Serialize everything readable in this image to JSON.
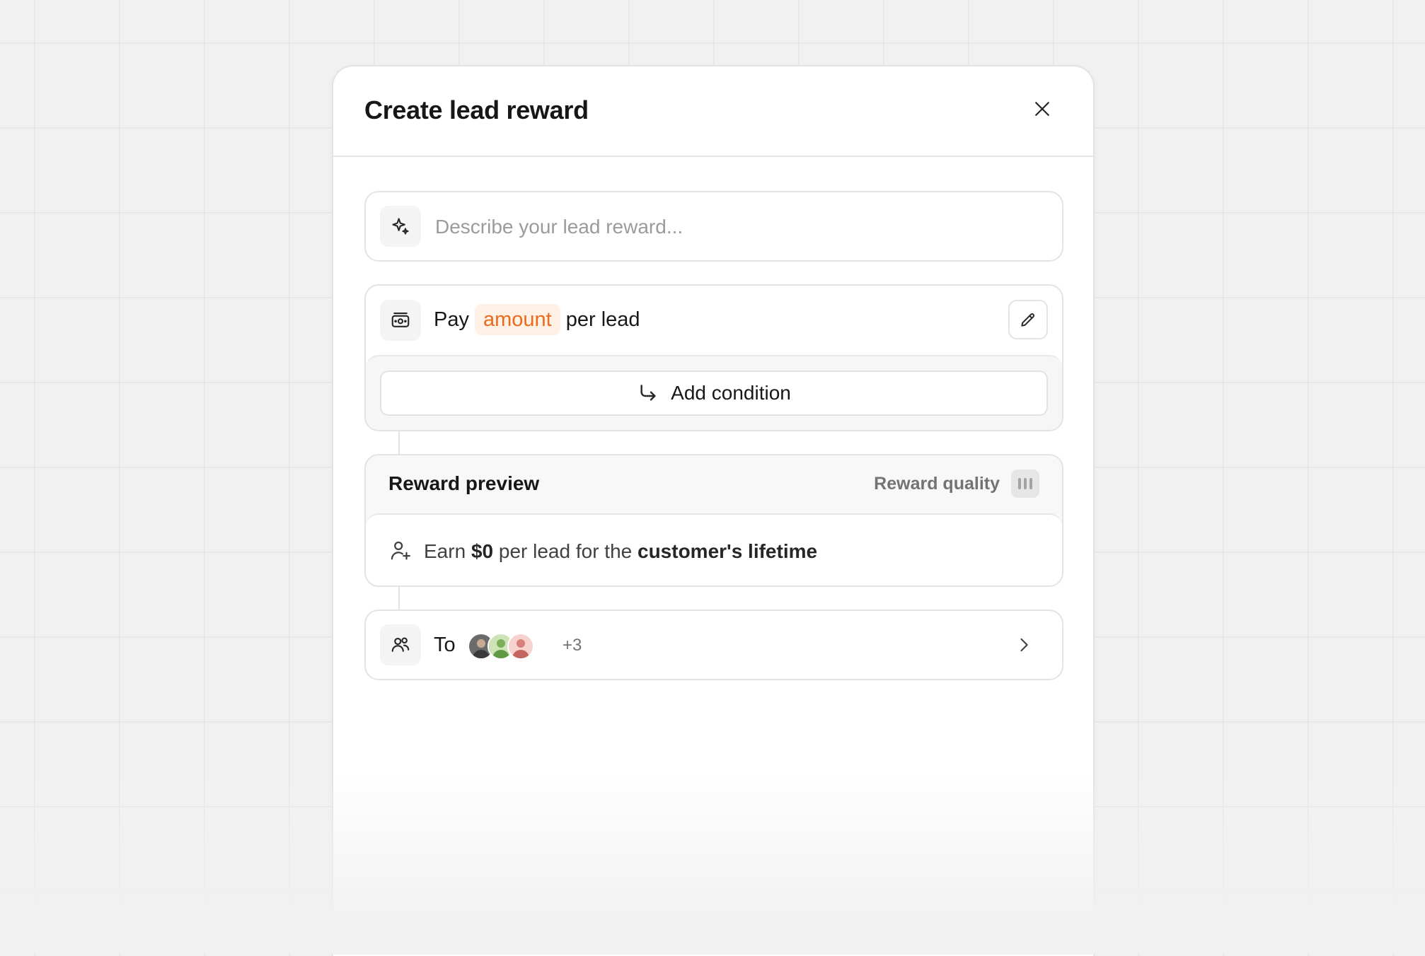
{
  "modal": {
    "title": "Create lead reward",
    "close_icon": "close-icon"
  },
  "describe": {
    "icon": "sparkle-icon",
    "placeholder": "Describe your lead reward...",
    "value": ""
  },
  "pay": {
    "icon": "money-icon",
    "prefix": "Pay",
    "amount_label": "amount",
    "suffix": "per lead",
    "edit_icon": "pencil-icon"
  },
  "condition": {
    "icon": "arrow-return-icon",
    "add_label": "Add condition"
  },
  "preview": {
    "title": "Reward preview",
    "quality_label": "Reward quality",
    "quality_icon": "signal-bars-icon",
    "earn": {
      "icon": "user-plus-icon",
      "part1": "Earn",
      "amount": "$0",
      "part2": "per lead for the",
      "duration": "customer's lifetime"
    }
  },
  "recipients": {
    "icon": "users-icon",
    "label": "To",
    "avatar_colors": [
      "#5b5b5b",
      "#7cae5a",
      "#d9807a"
    ],
    "extra_count": "+3",
    "chevron_icon": "chevron-right-icon"
  },
  "colors": {
    "accent_orange": "#ea6a1e",
    "accent_orange_bg": "#fff1e6",
    "background": "#f1f1f1"
  }
}
